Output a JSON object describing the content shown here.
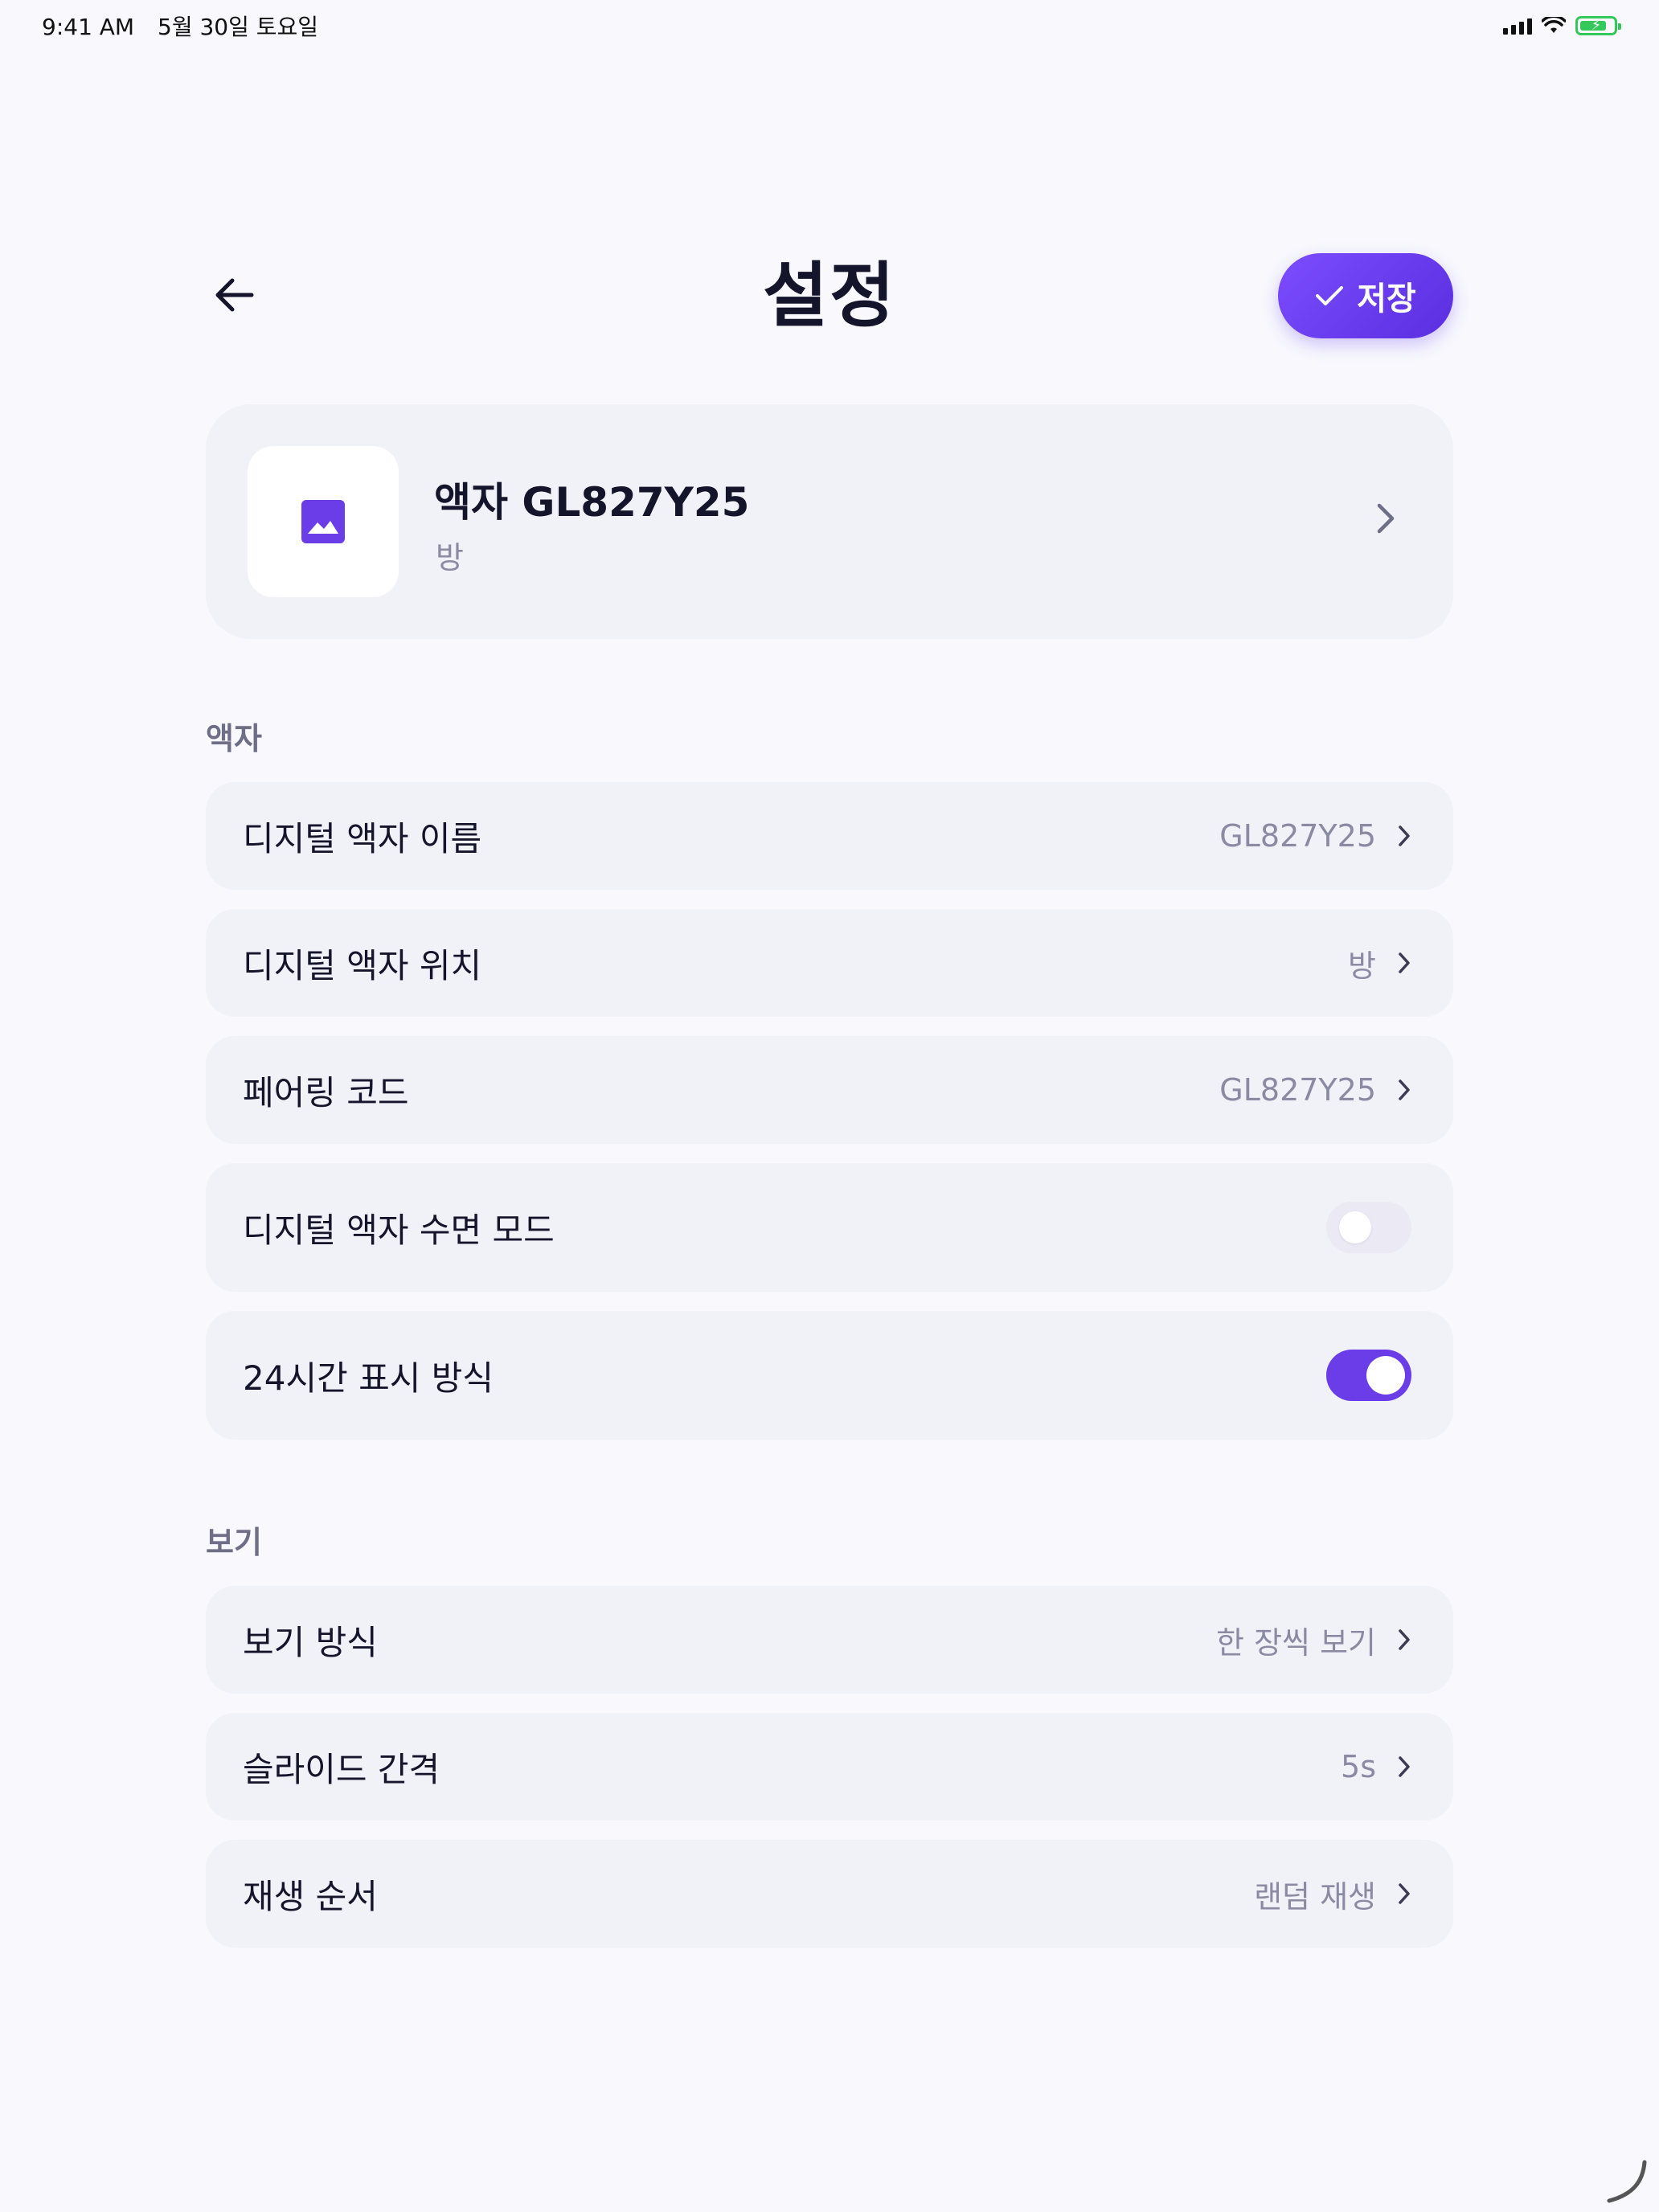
{
  "status_bar": {
    "time": "9:41 AM",
    "date": "5월 30일 토요일",
    "icons": [
      "cellular-signal-icon",
      "wifi-icon",
      "battery-charging-icon"
    ]
  },
  "header": {
    "title": "설정",
    "back_icon": "arrow-left-icon",
    "save_label": "저장",
    "save_icon": "checkmark-icon"
  },
  "device": {
    "name": "액자 GL827Y25",
    "location": "방",
    "icon": "image-icon"
  },
  "sections": {
    "frame": {
      "label": "액자",
      "rows": [
        {
          "label": "디지털 액자 이름",
          "value": "GL827Y25"
        },
        {
          "label": "디지털 액자 위치",
          "value": "방"
        },
        {
          "label": "페어링 코드",
          "value": "GL827Y25"
        },
        {
          "label": "디지털 액자 수면 모드",
          "toggle": false
        },
        {
          "label": "24시간 표시 방식",
          "toggle": true
        }
      ]
    },
    "view": {
      "label": "보기",
      "rows": [
        {
          "label": "보기 방식",
          "value": "한 장씩 보기"
        },
        {
          "label": "슬라이드 간격",
          "value": "5s"
        },
        {
          "label": "재생 순서",
          "value": "랜덤 재생"
        }
      ]
    }
  },
  "colors": {
    "accent": "#6A3DE8",
    "background": "#F8F8FD",
    "card": "#F1F1F8",
    "secondary_text": "#8A8AA3"
  }
}
